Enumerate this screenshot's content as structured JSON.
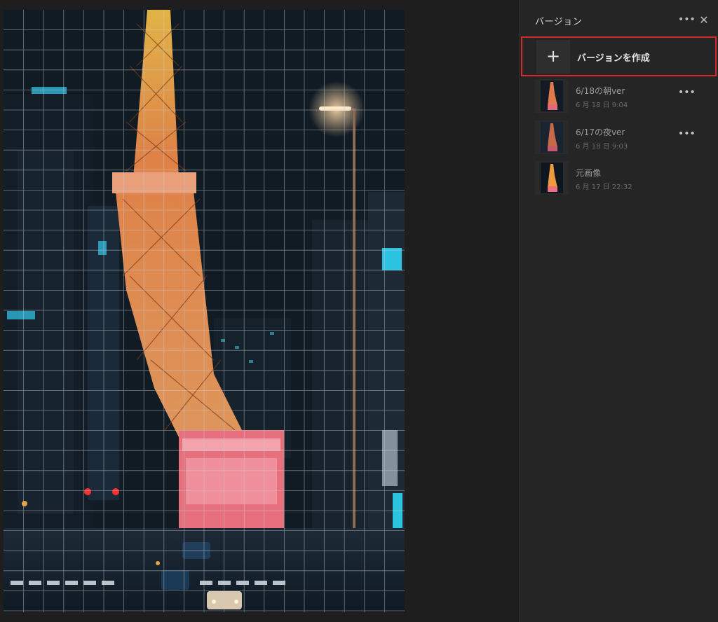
{
  "panel": {
    "title": "バージョン",
    "more_icon": "more-horizontal-icon",
    "close_icon": "close-icon",
    "create_button": {
      "label": "バージョンを作成",
      "icon": "plus-icon",
      "highlight_color": "#d62a2a"
    }
  },
  "versions": [
    {
      "name": "6/18の朝ver",
      "date": "6 月 18 日 9:04",
      "has_menu": true
    },
    {
      "name": "6/17の夜ver",
      "date": "6 月 18 日 9:03",
      "has_menu": true
    },
    {
      "name": "元画像",
      "date": "6 月 17 日 22:32",
      "has_menu": false
    }
  ],
  "canvas": {
    "image_subject": "Tokyo Tower at night street scene",
    "overlay": "grid"
  },
  "colors": {
    "panel_bg": "#252525",
    "canvas_bg": "#1e1e1e",
    "accent_red": "#d62a2a"
  }
}
